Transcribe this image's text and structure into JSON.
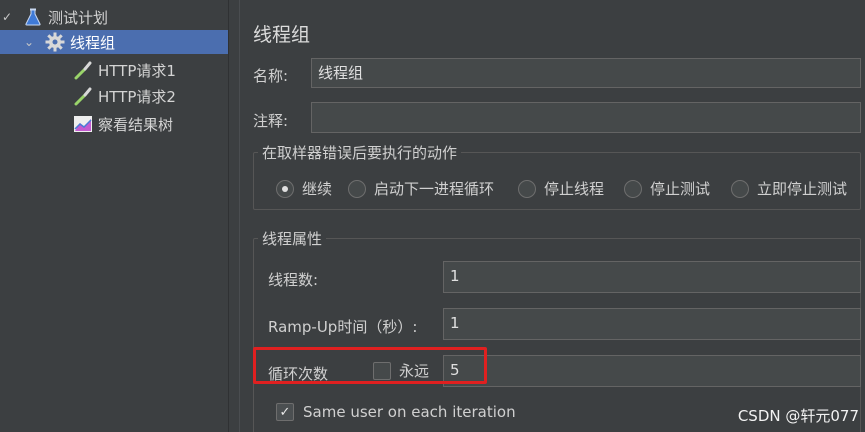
{
  "tree": {
    "items": [
      {
        "label": "测试计划",
        "icon": "flask-icon",
        "expanded": true
      },
      {
        "label": "线程组",
        "icon": "gear-icon",
        "expanded": true,
        "selected": true
      },
      {
        "label": "HTTP请求1",
        "icon": "pipette-icon"
      },
      {
        "label": "HTTP请求2",
        "icon": "pipette-icon"
      },
      {
        "label": "察看结果树",
        "icon": "chart-icon"
      }
    ]
  },
  "panel": {
    "title": "线程组",
    "name_label": "名称:",
    "name_value": "线程组",
    "comment_label": "注释:",
    "comment_value": "",
    "error_action": {
      "title": "在取样器错误后要执行的动作",
      "options": [
        "继续",
        "启动下一进程循环",
        "停止线程",
        "停止测试",
        "立即停止测试"
      ],
      "selected": "继续"
    },
    "thread_props": {
      "title": "线程属性",
      "threads_label": "线程数:",
      "threads_value": "1",
      "rampup_label": "Ramp-Up时间（秒）:",
      "rampup_value": "1",
      "loop_label": "循环次数",
      "forever_label": "永远",
      "forever_checked": false,
      "loop_value": "5",
      "same_user_label": "Same user on each iteration",
      "same_user_checked": true
    }
  },
  "watermark": "CSDN @轩元077",
  "colors": {
    "background": "#3c3f41",
    "selection": "#4b6eaf",
    "highlight_box": "#e02020",
    "field_bg": "#45494a"
  }
}
